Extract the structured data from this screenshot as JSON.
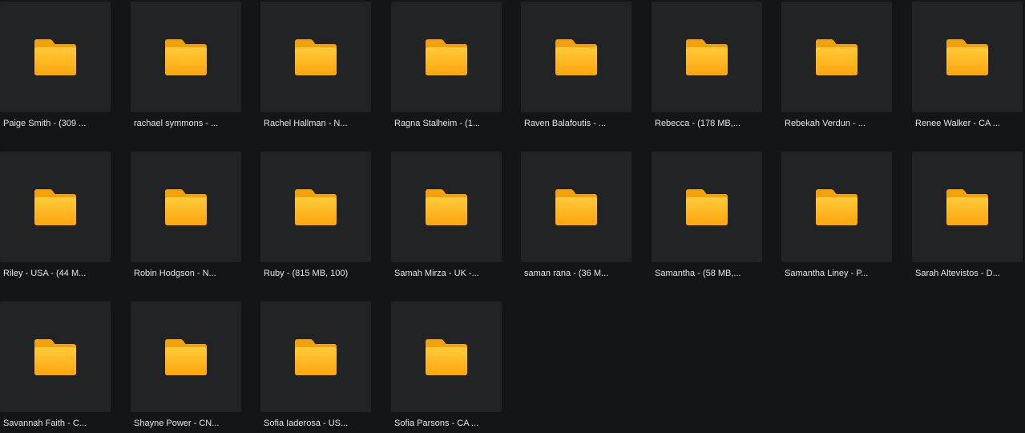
{
  "accent_color": "#ffb51e",
  "folder_icon": "folder-icon",
  "folders": [
    {
      "label": "Paige Smith - (309 ..."
    },
    {
      "label": "rachael symmons - ..."
    },
    {
      "label": "Rachel Hallman - N..."
    },
    {
      "label": "Ragna Stalheim - (1..."
    },
    {
      "label": "Raven Balafoutis - ..."
    },
    {
      "label": "Rebecca - (178 MB,..."
    },
    {
      "label": "Rebekah Verdun - ..."
    },
    {
      "label": "Renee Walker - CA ..."
    },
    {
      "label": "Riley - USA - (44 M..."
    },
    {
      "label": "Robin Hodgson - N..."
    },
    {
      "label": "Ruby - (815 MB, 100)"
    },
    {
      "label": "Samah Mirza - UK -..."
    },
    {
      "label": "saman rana - (36 M..."
    },
    {
      "label": "Samantha - (58 MB,..."
    },
    {
      "label": "Samantha Liney - P..."
    },
    {
      "label": "Sarah Altevistos - D..."
    },
    {
      "label": "Savannah Faith - C..."
    },
    {
      "label": "Shayne Power - CN..."
    },
    {
      "label": "Sofia Iaderosa - US..."
    },
    {
      "label": "Sofia Parsons - CA ..."
    }
  ]
}
